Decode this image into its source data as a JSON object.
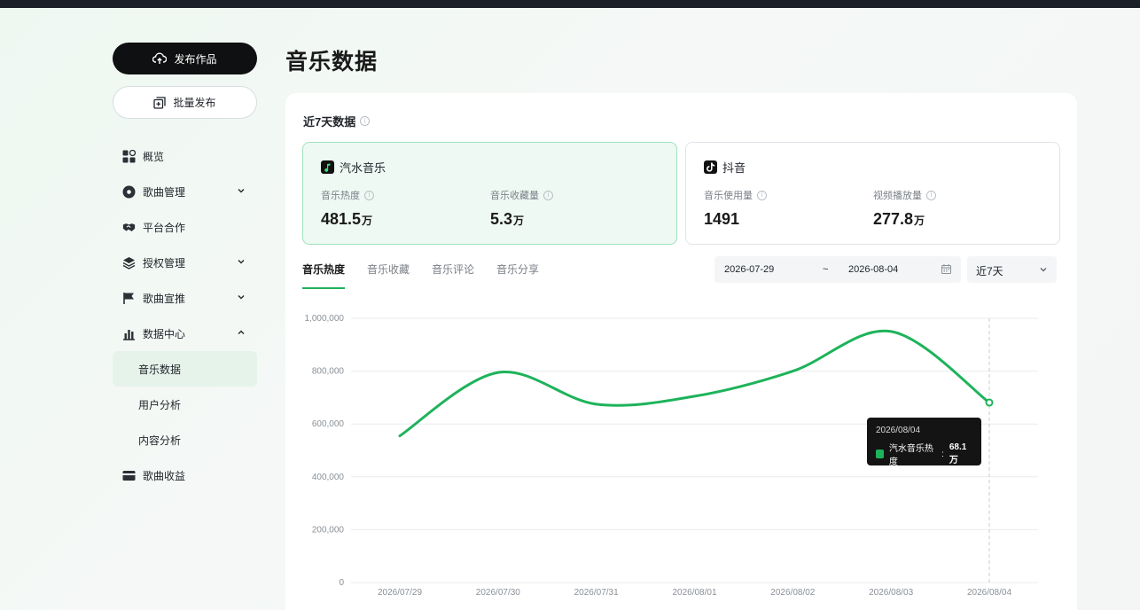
{
  "sidebar": {
    "publish_label": "发布作品",
    "batch_label": "批量发布",
    "items": [
      {
        "label": "概览"
      },
      {
        "label": "歌曲管理"
      },
      {
        "label": "平台合作"
      },
      {
        "label": "授权管理"
      },
      {
        "label": "歌曲宣推"
      },
      {
        "label": "数据中心"
      },
      {
        "label": "歌曲收益"
      }
    ],
    "sub_items": [
      {
        "label": "音乐数据"
      },
      {
        "label": "用户分析"
      },
      {
        "label": "内容分析"
      }
    ]
  },
  "page": {
    "title": "音乐数据"
  },
  "panel": {
    "heading": "近7天数据"
  },
  "cards": {
    "qishui": {
      "name": "汽水音乐",
      "m1_label": "音乐热度",
      "m1_value": "481.5",
      "m1_unit": "万",
      "m2_label": "音乐收藏量",
      "m2_value": "5.3",
      "m2_unit": "万"
    },
    "douyin": {
      "name": "抖音",
      "m1_label": "音乐使用量",
      "m1_value": "1491",
      "m2_label": "视频播放量",
      "m2_value": "277.8",
      "m2_unit": "万"
    }
  },
  "tabs": [
    {
      "label": "音乐热度"
    },
    {
      "label": "音乐收藏"
    },
    {
      "label": "音乐评论"
    },
    {
      "label": "音乐分享"
    }
  ],
  "date_filter": {
    "start": "2026-07-29",
    "sep": "~",
    "end": "2026-08-04",
    "range": "近7天"
  },
  "tooltip": {
    "date": "2026/08/04",
    "series": "汽水音乐热度",
    "value": "68.1万"
  },
  "colors": {
    "accent": "#1db35a",
    "grid": "#e8ebee",
    "axis_text": "#8a9097"
  },
  "chart_data": {
    "type": "line",
    "x": [
      "2026/07/29",
      "2026/07/30",
      "2026/07/31",
      "2026/08/01",
      "2026/08/02",
      "2026/08/03",
      "2026/08/04"
    ],
    "series": [
      {
        "values": [
          555000,
          795000,
          675000,
          705000,
          800000,
          950000,
          681000
        ]
      }
    ],
    "ylim": [
      0,
      1000000
    ],
    "yticks": [
      "0",
      "200,000",
      "400,000",
      "600,000",
      "800,000",
      "1,000,000"
    ],
    "grid": true
  }
}
